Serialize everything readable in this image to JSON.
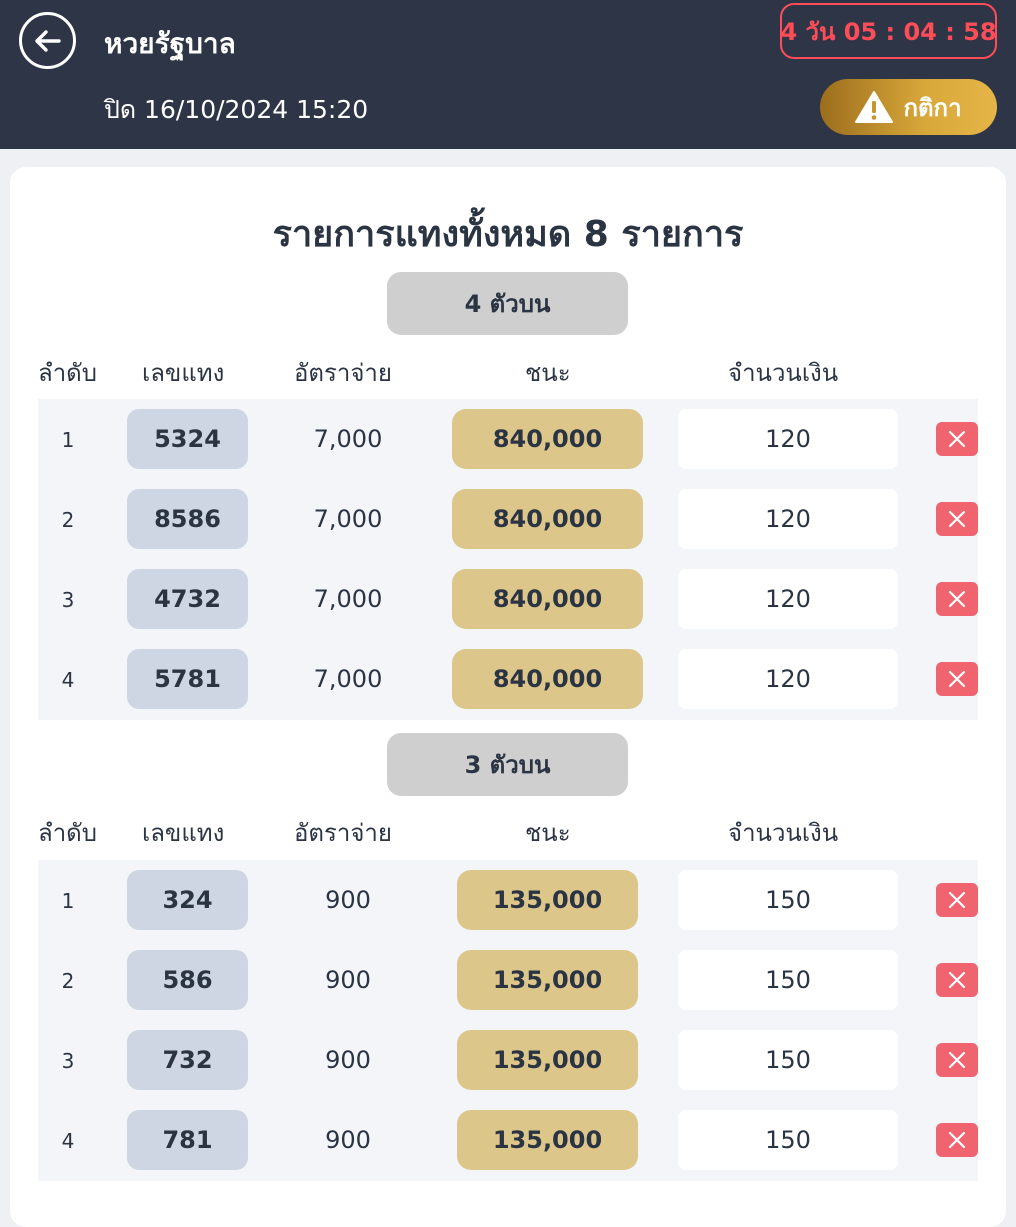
{
  "header": {
    "title": "หวยรัฐบาล",
    "closing": "ปิด 16/10/2024 15:20",
    "countdown": "4 วัน 05 : 04 : 58",
    "rules_label": "กติกา",
    "back_icon": "arrow-left-icon",
    "rules_icon": "warning-icon"
  },
  "summary": "รายการแทงทั้งหมด 8 รายการ",
  "columns": {
    "index": "ลำดับ",
    "number": "เลขแทง",
    "rate": "อัตราจ่าย",
    "win": "ชนะ",
    "amount": "จำนวนเงิน"
  },
  "sections": [
    {
      "label": "4 ตัวบน",
      "rows": [
        {
          "index": "1",
          "number": "5324",
          "rate": "7,000",
          "win": "840,000",
          "amount": "120"
        },
        {
          "index": "2",
          "number": "8586",
          "rate": "7,000",
          "win": "840,000",
          "amount": "120"
        },
        {
          "index": "3",
          "number": "4732",
          "rate": "7,000",
          "win": "840,000",
          "amount": "120"
        },
        {
          "index": "4",
          "number": "5781",
          "rate": "7,000",
          "win": "840,000",
          "amount": "120"
        }
      ]
    },
    {
      "label": "3 ตัวบน",
      "rows": [
        {
          "index": "1",
          "number": "324",
          "rate": "900",
          "win": "135,000",
          "amount": "150"
        },
        {
          "index": "2",
          "number": "586",
          "rate": "900",
          "win": "135,000",
          "amount": "150"
        },
        {
          "index": "3",
          "number": "732",
          "rate": "900",
          "win": "135,000",
          "amount": "150"
        },
        {
          "index": "4",
          "number": "781",
          "rate": "900",
          "win": "135,000",
          "amount": "150"
        }
      ]
    }
  ],
  "colors": {
    "header_bg": "#2e3546",
    "countdown_red": "#ff4d58",
    "rules_gold": "#d9a83a",
    "number_pill": "#cdd6e2",
    "win_pill": "#dcc68a",
    "delete_red": "#f06470"
  }
}
